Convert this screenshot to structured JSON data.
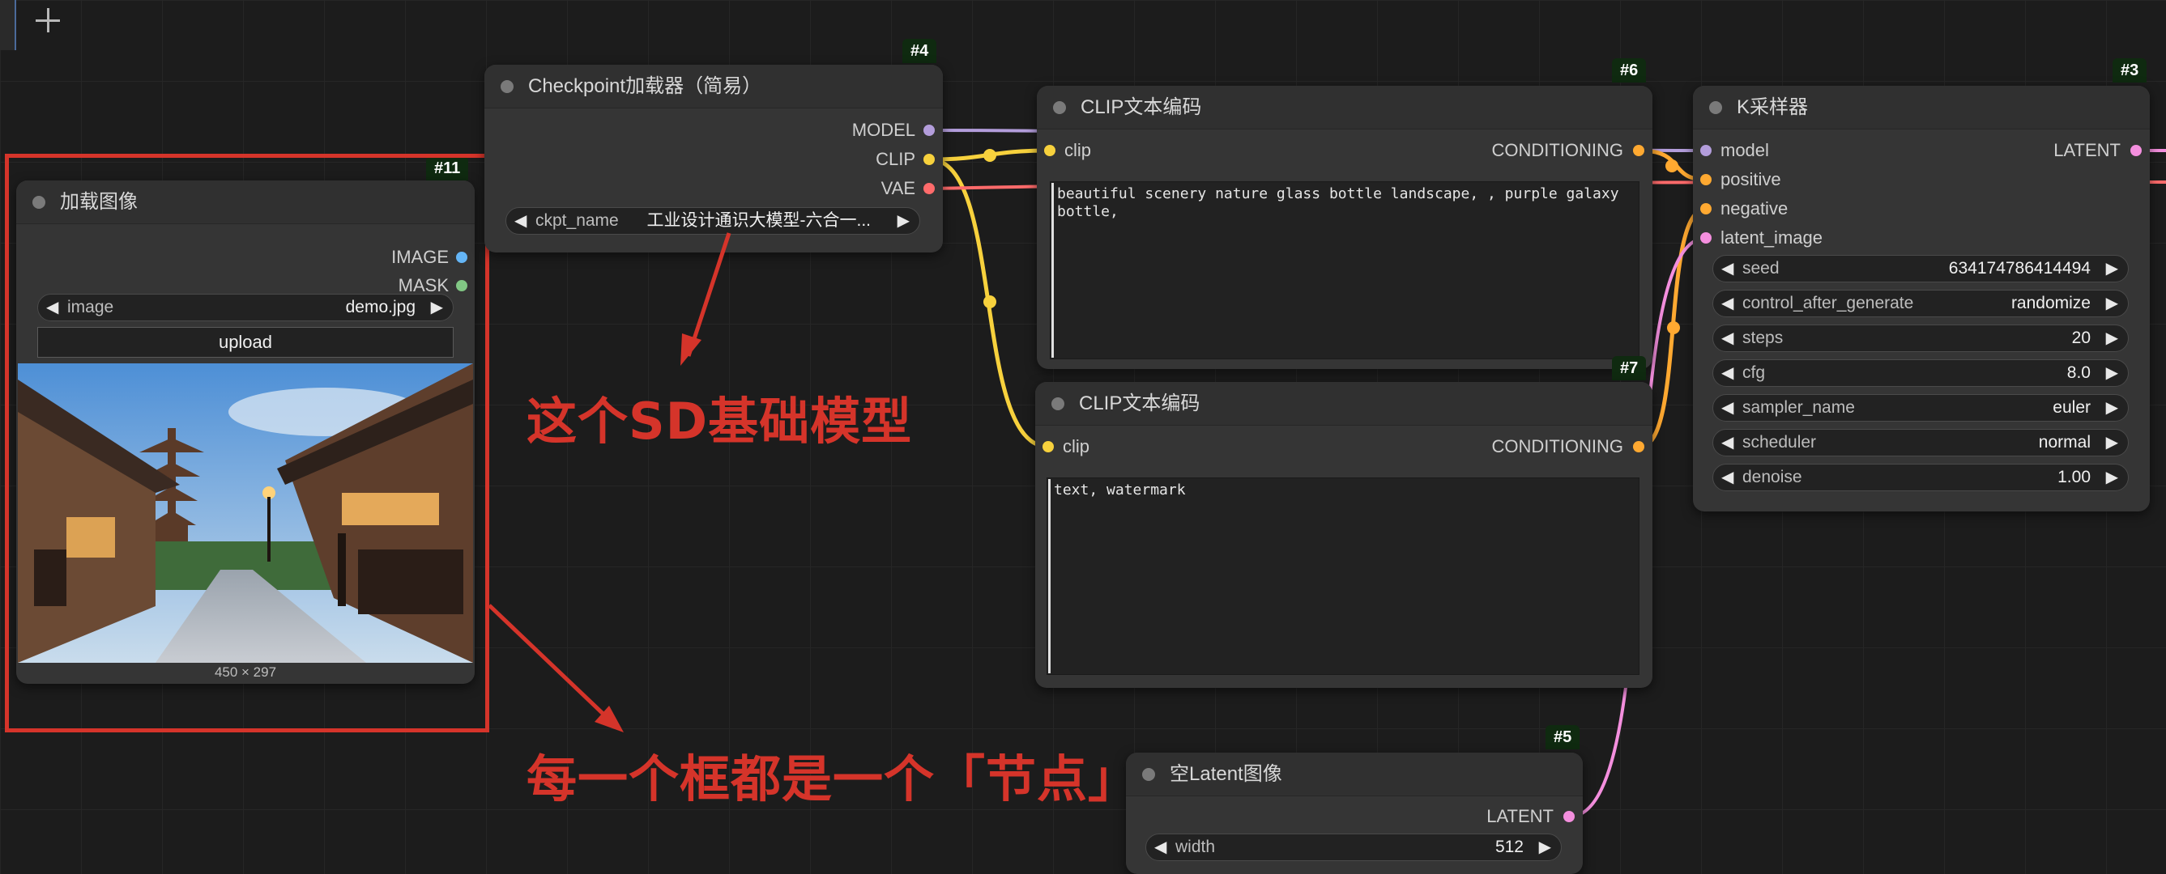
{
  "toolbar": {
    "add_icon": "plus-icon"
  },
  "colors": {
    "model": "#b39ddb",
    "clip": "#f7d13d",
    "vae": "#ff6b6b",
    "conditioning": "#ffa931",
    "latent": "#f48fde",
    "image": "#64b5f6",
    "mask": "#81c784",
    "annotation": "#d5342a",
    "id_badge": "#0f2a10"
  },
  "nodes": {
    "load_image": {
      "id": "#11",
      "title": "加载图像",
      "outputs": [
        "IMAGE",
        "MASK"
      ],
      "widget_image": {
        "label": "image",
        "value": "demo.jpg"
      },
      "upload_label": "upload",
      "preview_size": "450 × 297"
    },
    "checkpoint": {
      "id": "#4",
      "title": "Checkpoint加载器（简易）",
      "outputs": [
        "MODEL",
        "CLIP",
        "VAE"
      ],
      "widget_ckpt": {
        "label": "ckpt_name",
        "value": "工业设计通识大模型-六合一..."
      }
    },
    "clip_pos": {
      "id": "#6",
      "title": "CLIP文本编码",
      "input": "clip",
      "output": "CONDITIONING",
      "text": "beautiful scenery nature glass bottle landscape, , purple galaxy bottle,"
    },
    "clip_neg": {
      "id": "#7",
      "title": "CLIP文本编码",
      "input": "clip",
      "output": "CONDITIONING",
      "text": "text, watermark"
    },
    "ksampler": {
      "id": "#3",
      "title": "K采样器",
      "inputs": [
        "model",
        "positive",
        "negative",
        "latent_image"
      ],
      "output": "LATENT",
      "widgets": [
        {
          "label": "seed",
          "value": "634174786414494"
        },
        {
          "label": "control_after_generate",
          "value": "randomize"
        },
        {
          "label": "steps",
          "value": "20"
        },
        {
          "label": "cfg",
          "value": "8.0"
        },
        {
          "label": "sampler_name",
          "value": "euler"
        },
        {
          "label": "scheduler",
          "value": "normal"
        },
        {
          "label": "denoise",
          "value": "1.00"
        }
      ]
    },
    "empty_latent": {
      "id": "#5",
      "title": "空Latent图像",
      "output": "LATENT",
      "widget_width": {
        "label": "width",
        "value": "512"
      }
    }
  },
  "annotations": {
    "sd_model": "这个SD基础模型",
    "node_note": "每一个框都是一个「节点」"
  }
}
